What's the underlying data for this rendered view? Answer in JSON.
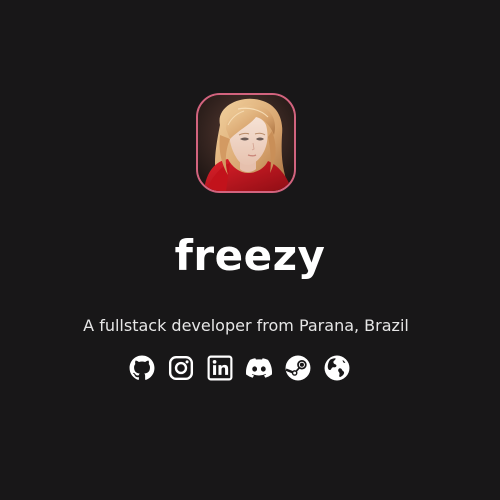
{
  "profile": {
    "avatar_icon": "profile-avatar",
    "name": "freezy",
    "tagline": "A fullstack developer from Parana, Brazil"
  },
  "social": [
    {
      "name": "github-icon"
    },
    {
      "name": "instagram-icon"
    },
    {
      "name": "linkedin-icon"
    },
    {
      "name": "discord-icon"
    },
    {
      "name": "steam-icon"
    },
    {
      "name": "globe-icon"
    }
  ],
  "colors": {
    "background": "#181718",
    "avatar_border": "#d2637e",
    "text": "#ffffff",
    "icon": "#ffffff"
  }
}
